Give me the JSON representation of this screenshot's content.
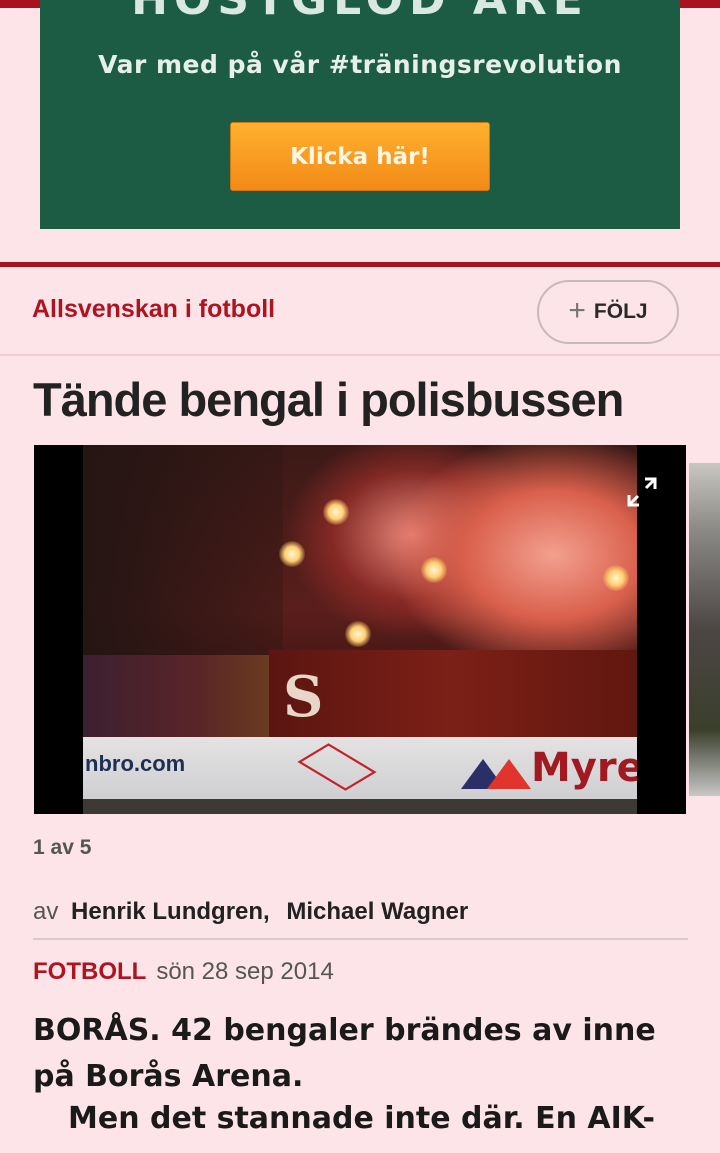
{
  "ad": {
    "headline_cut": "HÖSTGLÖD ÅRE",
    "tagline": "Var med på vår #träningsrevolution",
    "cta_label": "Klicka här!",
    "colors": {
      "background": "#1d5c44",
      "cta": "#f7a124"
    }
  },
  "section": {
    "title": "Allsvenskan i fotboll",
    "follow_label": "FÖLJ",
    "follow_icon": "plus-icon"
  },
  "article": {
    "headline": "Tände bengal i polisbussen",
    "gallery": {
      "counter": "1 av 5",
      "board_text_1": "nbro.com",
      "board_text_2": "Myre",
      "banner_text": "S I"
    },
    "byline": {
      "prefix": "av",
      "author_1": "Henrik Lundgren,",
      "author_2": "Michael Wagner"
    },
    "category": "FOTBOLL",
    "date": "sön 28 sep 2014",
    "lead": "BORÅS. 42 bengaler brändes av inne på Borås Arena.",
    "body_first_line": "Men det stannade inte där. En AIK-"
  },
  "colors": {
    "accent": "#b01320",
    "background": "#fde4e8"
  }
}
